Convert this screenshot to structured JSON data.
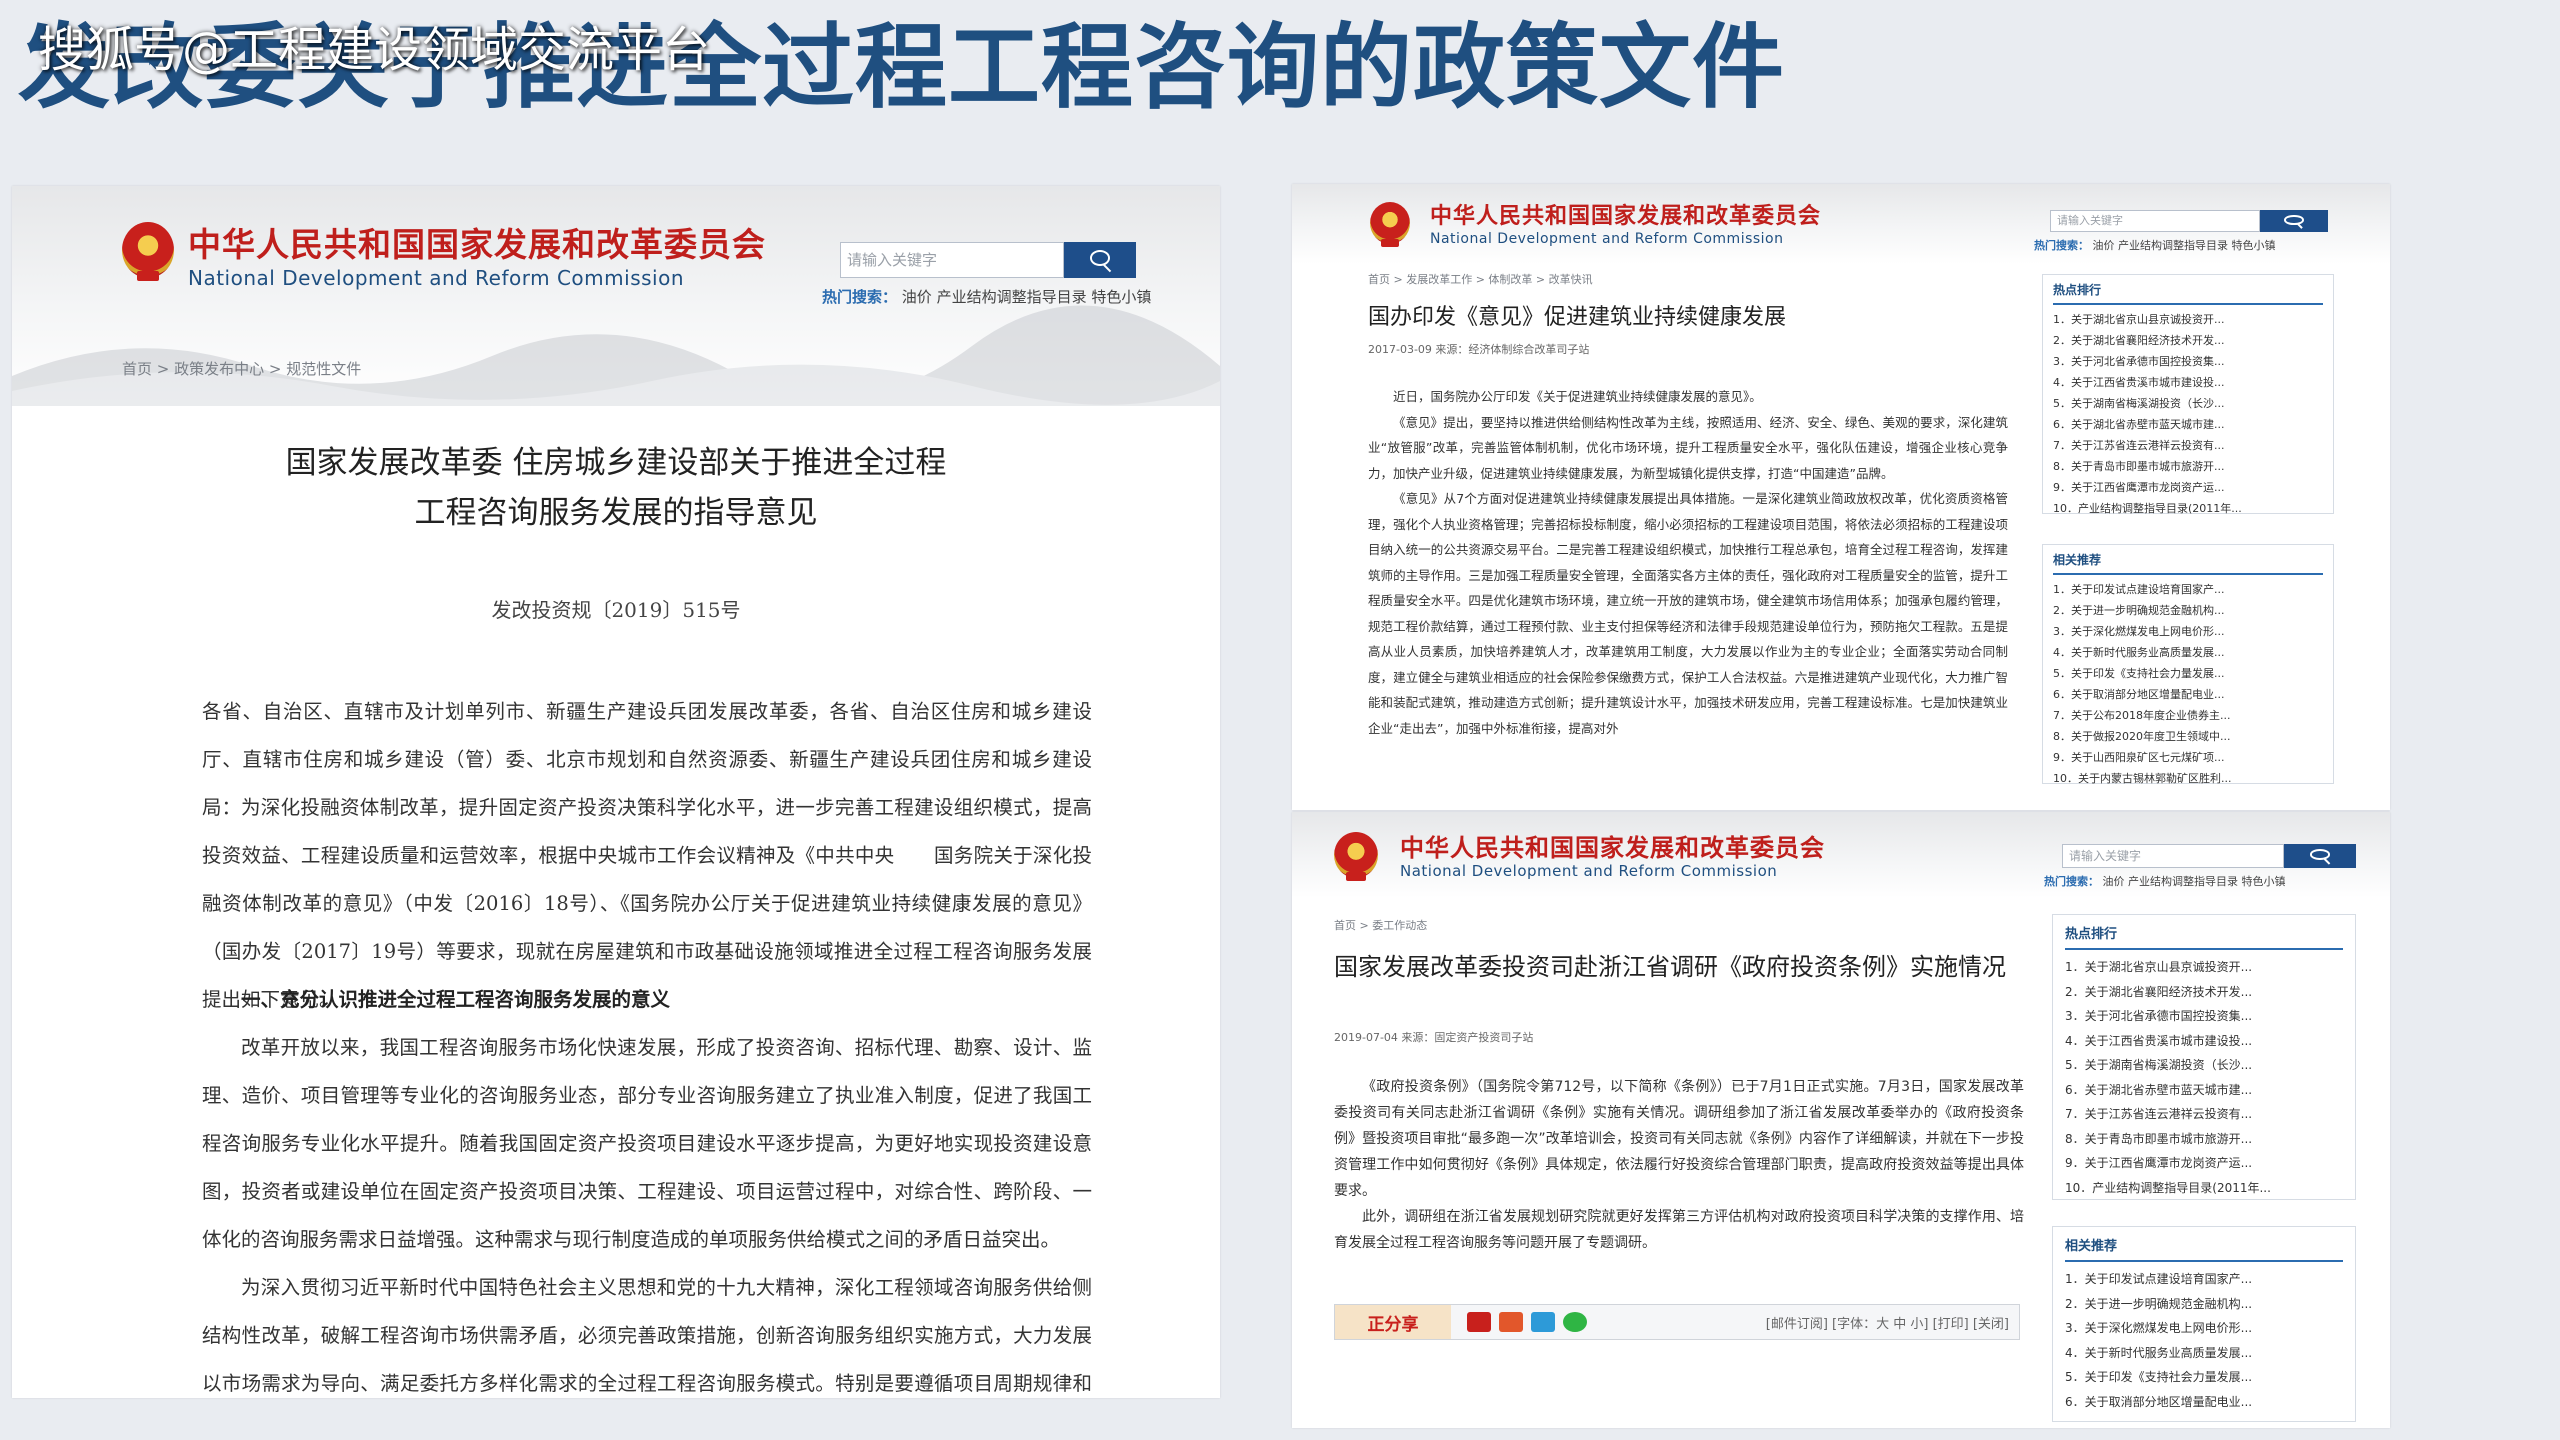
{
  "slide_title": "发改委关于推进全过程工程咨询的政策文件",
  "watermark": "搜狐号@工程建设领域交流平台",
  "org": {
    "name_cn": "中华人民共和国国家发展和改革委员会",
    "name_en": "National Development and Reform Commission",
    "search_placeholder": "请输入关键字",
    "hot_label": "热门搜索：",
    "hot_items": "油价   产业结构调整指导目录   特色小镇"
  },
  "left_doc": {
    "breadcrumb": "首页 > 政策发布中心 > 规范性文件",
    "title_line1": "国家发展改革委 住房城乡建设部关于推进全过程",
    "title_line2": "工程咨询服务发展的指导意见",
    "doc_number": "发改投资规〔2019〕515号",
    "p1": "各省、自治区、直辖市及计划单列市、新疆生产建设兵团发展改革委，各省、自治区住房和城乡建设厅、直辖市住房和城乡建设（管）委、北京市规划和自然资源委、新疆生产建设兵团住房和城乡建设局：",
    "p2": "为深化投融资体制改革，提升固定资产投资决策科学化水平，进一步完善工程建设组织模式，提高投资效益、工程建设质量和运营效率，根据中央城市工作会议精神及《中共中央　　国务院关于深化投融资体制改革的意见》（中发〔2016〕18号）、《国务院办公厅关于促进建筑业持续健康发展的意见》（国办发〔2017〕19号）等要求，现就在房屋建筑和市政基础设施领域推进全过程工程咨询服务发展提出如下意见。",
    "heading1": "一、充分认识推进全过程工程咨询服务发展的意义",
    "p3": "改革开放以来，我国工程咨询服务市场化快速发展，形成了投资咨询、招标代理、勘察、设计、监理、造价、项目管理等专业化的咨询服务业态，部分专业咨询服务建立了执业准入制度，促进了我国工程咨询服务专业化水平提升。随着我国固定资产投资项目建设水平逐步提高，为更好地实现投资建设意图，投资者或建设单位在固定资产投资项目决策、工程建设、项目运营过程中，对综合性、跨阶段、一体化的咨询服务需求日益增强。这种需求与现行制度造成的单项服务供给模式之间的矛盾日益突出。",
    "p4": "为深入贯彻习近平新时代中国特色社会主义思想和党的十九大精神，深化工程领域咨询服务供给侧结构性改革，破解工程咨询市场供需矛盾，必须完善政策措施，创新咨询服务组织实施方式，大力发展以市场需求为导向、满足委托方多样化需求的全过程工程咨询服务模式。特别是要遵循项目周期规律和建设程序的客观要求，在项目决策和建设实施两"
  },
  "top_right": {
    "breadcrumb": "首页 > 发展改革工作 > 体制改革 > 改革快讯",
    "title": "国办印发《意见》促进建筑业持续健康发展",
    "date": "2017-03-09  来源：经济体制综合改革司子站",
    "p1": "近日，国务院办公厅印发《关于促进建筑业持续健康发展的意见》。",
    "p2": "《意见》提出，要坚持以推进供给侧结构性改革为主线，按照适用、经济、安全、绿色、美观的要求，深化建筑业“放管服”改革，完善监管体制机制，优化市场环境，提升工程质量安全水平，强化队伍建设，增强企业核心竞争力，加快产业升级，促进建筑业持续健康发展，为新型城镇化提供支撑，打造“中国建造”品牌。",
    "p3": "《意见》从7个方面对促进建筑业持续健康发展提出具体措施。一是深化建筑业简政放权改革，优化资质资格管理，强化个人执业资格管理；完善招标投标制度，缩小必须招标的工程建设项目范围，将依法必须招标的工程建设项目纳入统一的公共资源交易平台。二是完善工程建设组织模式，加快推行工程总承包，培育全过程工程咨询，发挥建筑师的主导作用。三是加强工程质量安全管理，全面落实各方主体的责任，强化政府对工程质量安全的监管，提升工程质量安全水平。四是优化建筑市场环境，建立统一开放的建筑市场，健全建筑市场信用体系；加强承包履约管理，规范工程价款结算，通过工程预付款、业主支付担保等经济和法律手段规范建设单位行为，预防拖欠工程款。五是提高从业人员素质，加快培养建筑人才，改革建筑用工制度，大力发展以作业为主的专业企业；全面落实劳动合同制度，建立健全与建筑业相适应的社会保险参保缴费方式，保护工人合法权益。六是推进建筑产业现代化，大力推广智能和装配式建筑，推动建造方式创新；提升建筑设计水平，加强技术研发应用，完善工程建设标准。七是加快建筑业企业“走出去”，加强中外标准衔接，提高对外",
    "hot_rank_title": "热点排行",
    "hot_rank": [
      "1．关于湖北省京山县京诚投资开...",
      "2．关于湖北省襄阳经济技术开发...",
      "3．关于河北省承德市国控投资集...",
      "4．关于江西省贵溪市城市建设投...",
      "5．关于湖南省梅溪湖投资（长沙...",
      "6．关于湖北省赤壁市蓝天城市建...",
      "7．关于江苏省连云港祥云投资有...",
      "8．关于青岛市即墨市城市旅游开...",
      "9．关于江西省鹰潭市龙岗资产运...",
      "10．产业结构调整指导目录(2011年..."
    ],
    "related_title": "相关推荐",
    "related": [
      "1．关于印发试点建设培育国家产...",
      "2．关于进一步明确规范金融机构...",
      "3．关于深化燃煤发电上网电价形...",
      "4．关于新时代服务业高质量发展...",
      "5．关于印发《支持社会力量发展...",
      "6．关于取消部分地区增量配电业...",
      "7．关于公布2018年度企业债券主...",
      "8．关于做报2020年度卫生领域中...",
      "9．关于山西阳泉矿区七元煤矿项...",
      "10．关于内蒙古锡林郭勒矿区胜利..."
    ]
  },
  "bottom_right": {
    "breadcrumb": "首页 > 委工作动态",
    "title": "国家发展改革委投资司赴浙江省调研《政府投资条例》实施情况",
    "date": "2019-07-04  来源：固定资产投资司子站",
    "p1": "《政府投资条例》（国务院令第712号，以下简称《条例》）已于7月1日正式实施。7月3日，国家发展改革委投资司有关同志赴浙江省调研《条例》实施有关情况。调研组参加了浙江省发展改革委举办的《政府投资条例》暨投资项目审批“最多跑一次”改革培训会，投资司有关同志就《条例》内容作了详细解读，并就在下一步投资管理工作中如何贯彻好《条例》具体规定，依法履行好投资综合管理部门职责，提高政府投资效益等提出具体要求。",
    "p2": "此外，调研组在浙江省发展规划研究院就更好发挥第三方评估机构对政府投资项目科学决策的支撑作用、培育发展全过程工程咨询服务等问题开展了专题调研。",
    "share_label": "正分享",
    "share_options": "[邮件订阅]   [字体：大  中  小]   [打印]   [关闭]",
    "hot_rank_title": "热点排行",
    "hot_rank": [
      "1．关于湖北省京山县京诚投资开...",
      "2．关于湖北省襄阳经济技术开发...",
      "3．关于河北省承德市国控投资集...",
      "4．关于江西省贵溪市城市建设投...",
      "5．关于湖南省梅溪湖投资（长沙...",
      "6．关于湖北省赤壁市蓝天城市建...",
      "7．关于江苏省连云港祥云投资有...",
      "8．关于青岛市即墨市城市旅游开...",
      "9．关于江西省鹰潭市龙岗资产运...",
      "10．产业结构调整指导目录(2011年..."
    ],
    "related_title": "相关推荐",
    "related": [
      "1．关于印发试点建设培育国家产...",
      "2．关于进一步明确规范金融机构...",
      "3．关于深化燃煤发电上网电价形...",
      "4．关于新时代服务业高质量发展...",
      "5．关于印发《支持社会力量发展...",
      "6．关于取消部分地区增量配电业..."
    ]
  }
}
